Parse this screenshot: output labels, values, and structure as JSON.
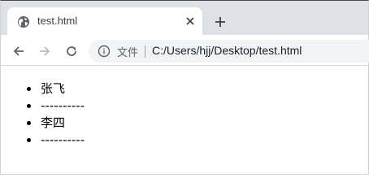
{
  "tab": {
    "title": "test.html",
    "icon": "globe-icon"
  },
  "toolbar": {
    "address_label": "文件",
    "url": "C:/Users/hjj/Desktop/test.html"
  },
  "content": {
    "list_items": [
      "张飞",
      "----------",
      "李四",
      "----------"
    ]
  }
}
